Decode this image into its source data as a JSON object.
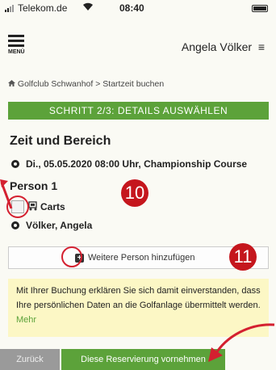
{
  "status_bar": {
    "carrier": "Telekom.de",
    "time": "08:40"
  },
  "topbar": {
    "menu_label": "MENÜ",
    "user_name": "Angela Völker"
  },
  "breadcrumb": {
    "items": [
      "Golfclub Schwanhof",
      "Startzeit buchen"
    ],
    "separator": ">"
  },
  "step_banner": "SCHRITT 2/3: DETAILS AUSWÄHLEN",
  "time_section": {
    "title": "Zeit und Bereich",
    "selection": "Di., 05.05.2020 08:00 Uhr, Championship Course"
  },
  "person_section": {
    "title": "Person 1",
    "cart_label": "Carts",
    "person_name": "Völker, Angela"
  },
  "add_person_label": "Weitere Person hinzufügen",
  "notice": {
    "text": "Mit Ihrer Buchung erklären Sie sich damit einverstanden, dass Ihre persönlichen Daten an die Golfanlage übermittelt werden.",
    "more_link": "Mehr"
  },
  "buttons": {
    "back": "Zurück",
    "submit": "Diese Reservierung vornehmen"
  },
  "annotations": {
    "badge_1": "10",
    "badge_2": "11"
  },
  "colors": {
    "accent_green": "#5ca23a",
    "annotation_red": "#c5161d",
    "notice_bg": "#fcf7c5"
  }
}
